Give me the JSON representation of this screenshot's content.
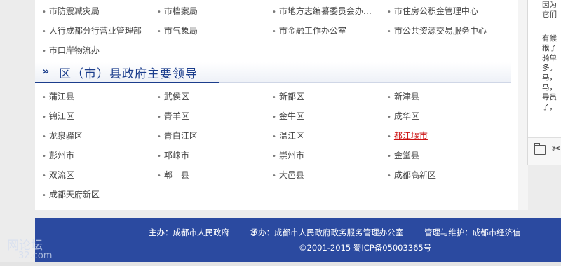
{
  "top_links": [
    [
      "市防震减灾局",
      "市档案局",
      "市地方志编纂委员会办…",
      "市住房公积金管理中心"
    ],
    [
      "人行成都分行营业管理部",
      "市气象局",
      "市金融工作办公室",
      "市公共资源交易服务中心"
    ],
    [
      "市口岸物流办"
    ]
  ],
  "section": {
    "chevron": "»",
    "title": "区（市）县政府主要领导"
  },
  "district_links": [
    [
      "蒲江县",
      "武侯区",
      "新都区",
      "新津县"
    ],
    [
      "锦江区",
      "青羊区",
      "金牛区",
      "成华区"
    ],
    [
      "龙泉驿区",
      "青白江区",
      "温江区",
      "都江堰市"
    ],
    [
      "彭州市",
      "邛崃市",
      "崇州市",
      "金堂县"
    ],
    [
      "双流区",
      "郫　县",
      "大邑县",
      "成都高新区"
    ],
    [
      "成都天府新区"
    ]
  ],
  "side_panel": {
    "lines_top": [
      "因为",
      "它们"
    ],
    "lines_mid": [
      "有猴",
      "猴子",
      "骑单",
      "多。",
      "马，",
      "马，",
      "导员",
      "了，"
    ]
  },
  "footer": {
    "host": "主办：成都市人民政府",
    "organizer": "承办：成都市人民政府政务服务管理办公室",
    "maintainer": "管理与维护：成都市经济信",
    "copyright": "©2001-2015 蜀ICP备05003365号"
  },
  "watermark": {
    "text": "网论坛",
    "sub": "32.com"
  },
  "colors": {
    "footer_bg": "#2b4aa0",
    "section_blue": "#1b3d8c",
    "active_link": "#cc1111"
  }
}
